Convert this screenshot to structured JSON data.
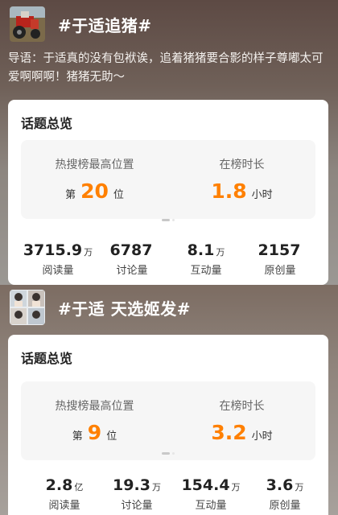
{
  "topics": [
    {
      "tag": "#于适追猪#",
      "intro": "导语：于适真的没有包袱诶，追着猪猪要合影的样子尊嘟太可爱啊啊啊！猪猪无助～",
      "card": {
        "title": "话题总览",
        "rank_label": "热搜榜最高位置",
        "rank_prefix": "第",
        "rank_value": "20",
        "rank_suffix": "位",
        "duration_label": "在榜时长",
        "duration_value": "1.8",
        "duration_unit": "小时"
      },
      "stats": [
        {
          "value": "3715.9",
          "unit": "万",
          "label": "阅读量"
        },
        {
          "value": "6787",
          "unit": "",
          "label": "讨论量"
        },
        {
          "value": "8.1",
          "unit": "万",
          "label": "互动量"
        },
        {
          "value": "2157",
          "unit": "",
          "label": "原创量"
        }
      ]
    },
    {
      "tag": "#于适 天选姬发#",
      "intro": "",
      "card": {
        "title": "话题总览",
        "rank_label": "热搜榜最高位置",
        "rank_prefix": "第",
        "rank_value": "9",
        "rank_suffix": "位",
        "duration_label": "在榜时长",
        "duration_value": "3.2",
        "duration_unit": "小时"
      },
      "stats": [
        {
          "value": "2.8",
          "unit": "亿",
          "label": "阅读量"
        },
        {
          "value": "19.3",
          "unit": "万",
          "label": "讨论量"
        },
        {
          "value": "154.4",
          "unit": "万",
          "label": "互动量"
        },
        {
          "value": "3.6",
          "unit": "万",
          "label": "原创量"
        }
      ]
    }
  ],
  "colors": {
    "accent": "#ff8000",
    "card": "#ffffff",
    "panel": "#f6f6f6"
  },
  "icons": [
    "topic-thumbnail-tractor",
    "topic-thumbnail-portraits"
  ]
}
